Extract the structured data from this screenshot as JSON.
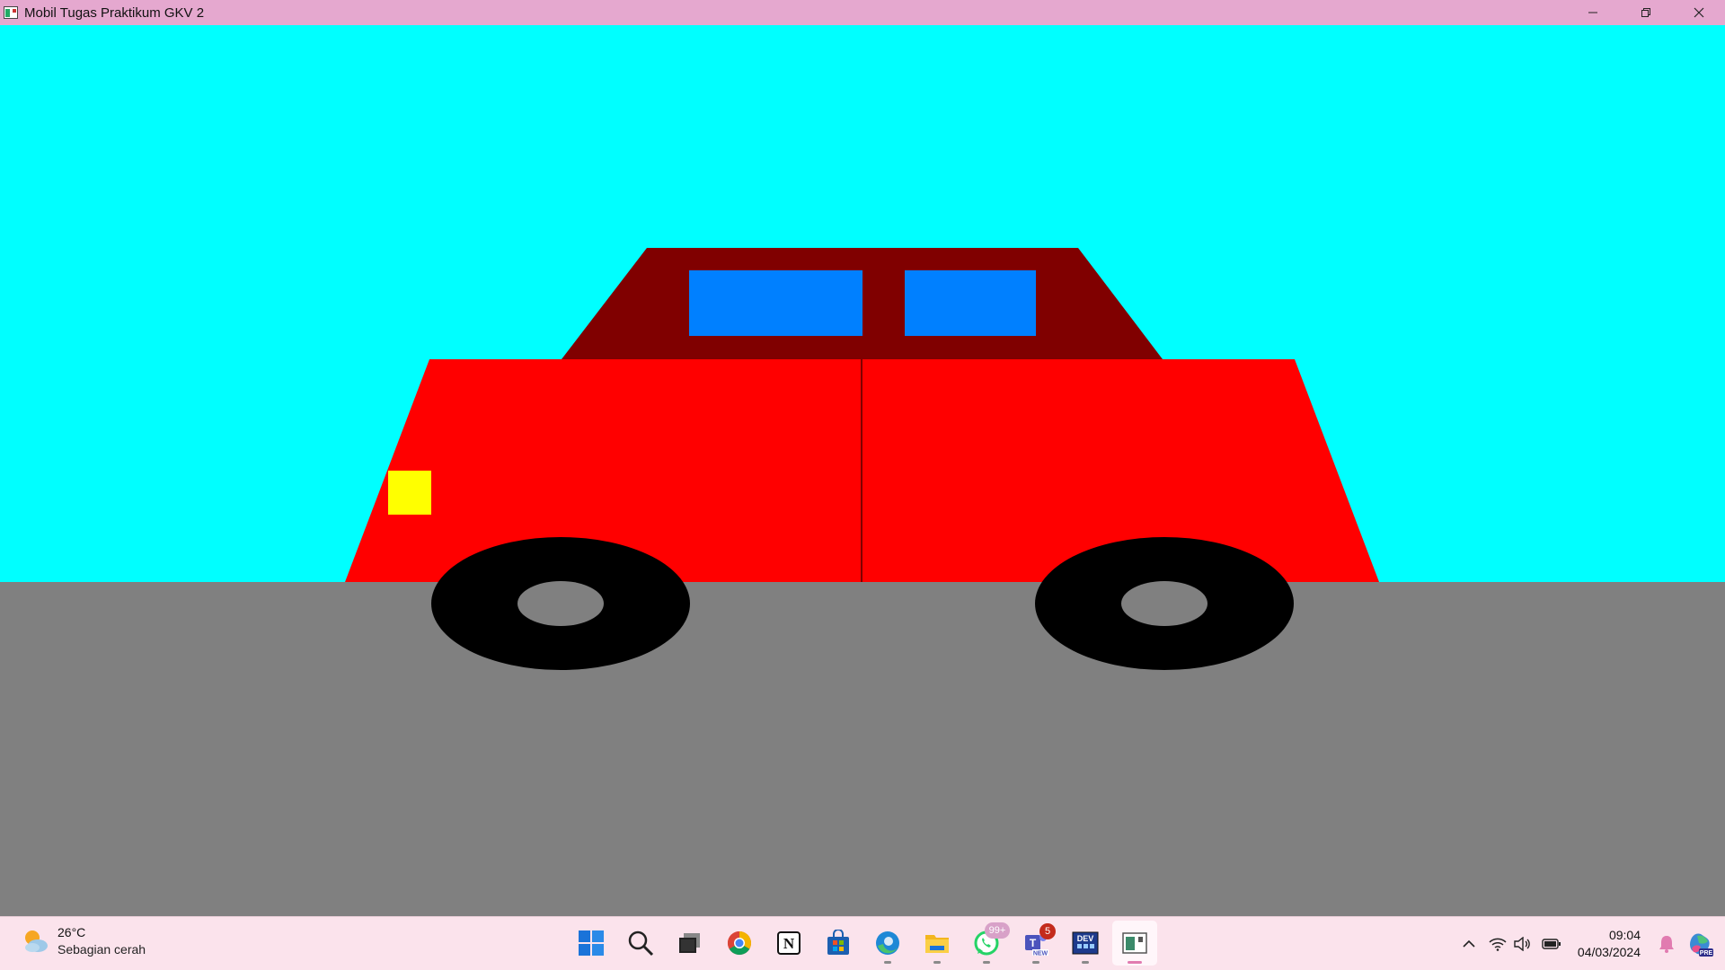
{
  "window": {
    "title": "Mobil Tugas Praktikum GKV 2",
    "controls": [
      "minimize",
      "restore",
      "close"
    ]
  },
  "scene": {
    "colors": {
      "sky": "#00ffff",
      "road": "#808080",
      "body": "#ff0000",
      "cabin": "#800000",
      "window": "#0080ff",
      "headlight": "#ffff00",
      "tire": "#000000",
      "hubcap": "#808080",
      "door_line": "#800000"
    }
  },
  "taskbar": {
    "weather": {
      "temp": "26°C",
      "desc": "Sebagian cerah",
      "icon": "partly-sunny-icon"
    },
    "apps": [
      {
        "name": "start",
        "icon": "windows-start-icon"
      },
      {
        "name": "search",
        "icon": "search-icon"
      },
      {
        "name": "task-view",
        "icon": "task-view-icon"
      },
      {
        "name": "chrome",
        "icon": "chrome-icon"
      },
      {
        "name": "notion",
        "icon": "notion-icon"
      },
      {
        "name": "store",
        "icon": "microsoft-store-icon"
      },
      {
        "name": "edge",
        "icon": "edge-icon"
      },
      {
        "name": "file-explorer",
        "icon": "folder-icon"
      },
      {
        "name": "whatsapp",
        "icon": "whatsapp-icon",
        "badge": "99+"
      },
      {
        "name": "teams",
        "icon": "teams-icon",
        "badge": "5"
      },
      {
        "name": "dev-cpp",
        "icon": "dev-cpp-icon"
      },
      {
        "name": "opengl-app",
        "icon": "opengl-window-icon"
      }
    ],
    "tray": {
      "time": "09:04",
      "date": "04/03/2024"
    }
  }
}
